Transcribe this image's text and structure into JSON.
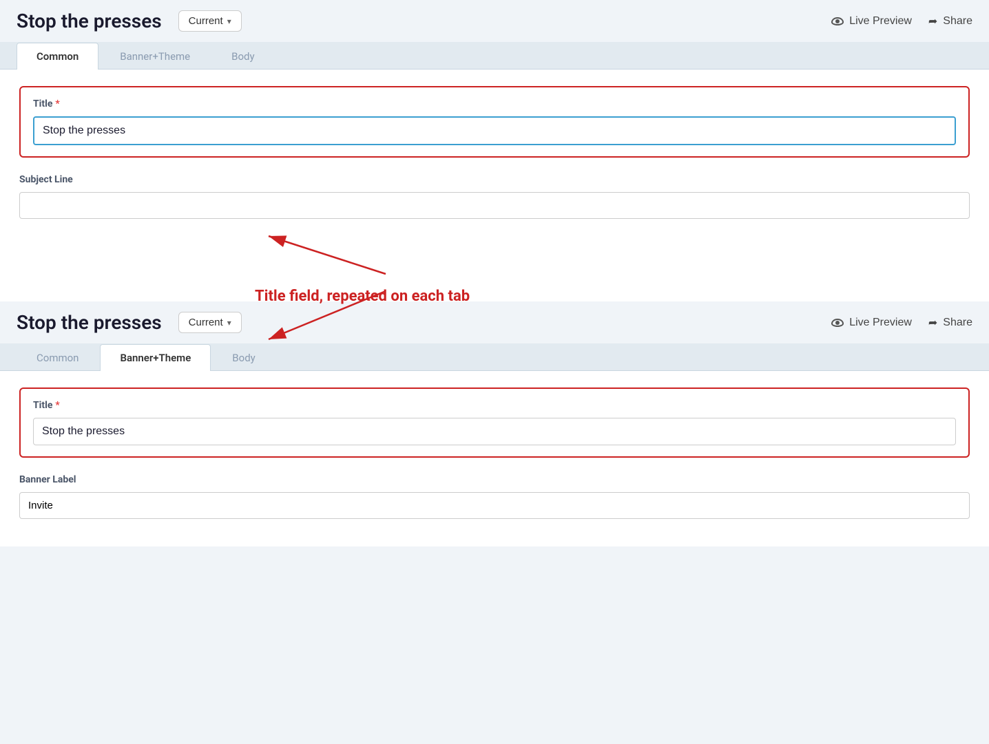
{
  "app": {
    "title": "Stop the presses"
  },
  "sections": [
    {
      "id": "section-top",
      "header": {
        "title": "Stop the presses",
        "version_dropdown": {
          "label": "Current",
          "chevron": "▾"
        },
        "live_preview_label": "Live Preview",
        "share_label": "Share"
      },
      "tabs": [
        {
          "id": "common",
          "label": "Common",
          "active": true
        },
        {
          "id": "banner-theme",
          "label": "Banner+Theme",
          "active": false
        },
        {
          "id": "body",
          "label": "Body",
          "active": false
        }
      ],
      "fields": {
        "title_label": "Title",
        "title_required": "*",
        "title_value": "Stop the presses",
        "subject_label": "Subject Line",
        "subject_value": "",
        "subject_placeholder": ""
      }
    },
    {
      "id": "section-bottom",
      "header": {
        "title": "Stop the presses",
        "version_dropdown": {
          "label": "Current",
          "chevron": "▾"
        },
        "live_preview_label": "Live Preview",
        "share_label": "Share"
      },
      "tabs": [
        {
          "id": "common",
          "label": "Common",
          "active": false
        },
        {
          "id": "banner-theme",
          "label": "Banner+Theme",
          "active": true
        },
        {
          "id": "body",
          "label": "Body",
          "active": false
        }
      ],
      "fields": {
        "title_label": "Title",
        "title_required": "*",
        "title_value": "Stop the presses",
        "banner_label": "Banner Label",
        "banner_value": "Invite"
      }
    }
  ],
  "annotation": {
    "text": "Title field, repeated on each tab",
    "arrow_color": "#cc2222"
  }
}
